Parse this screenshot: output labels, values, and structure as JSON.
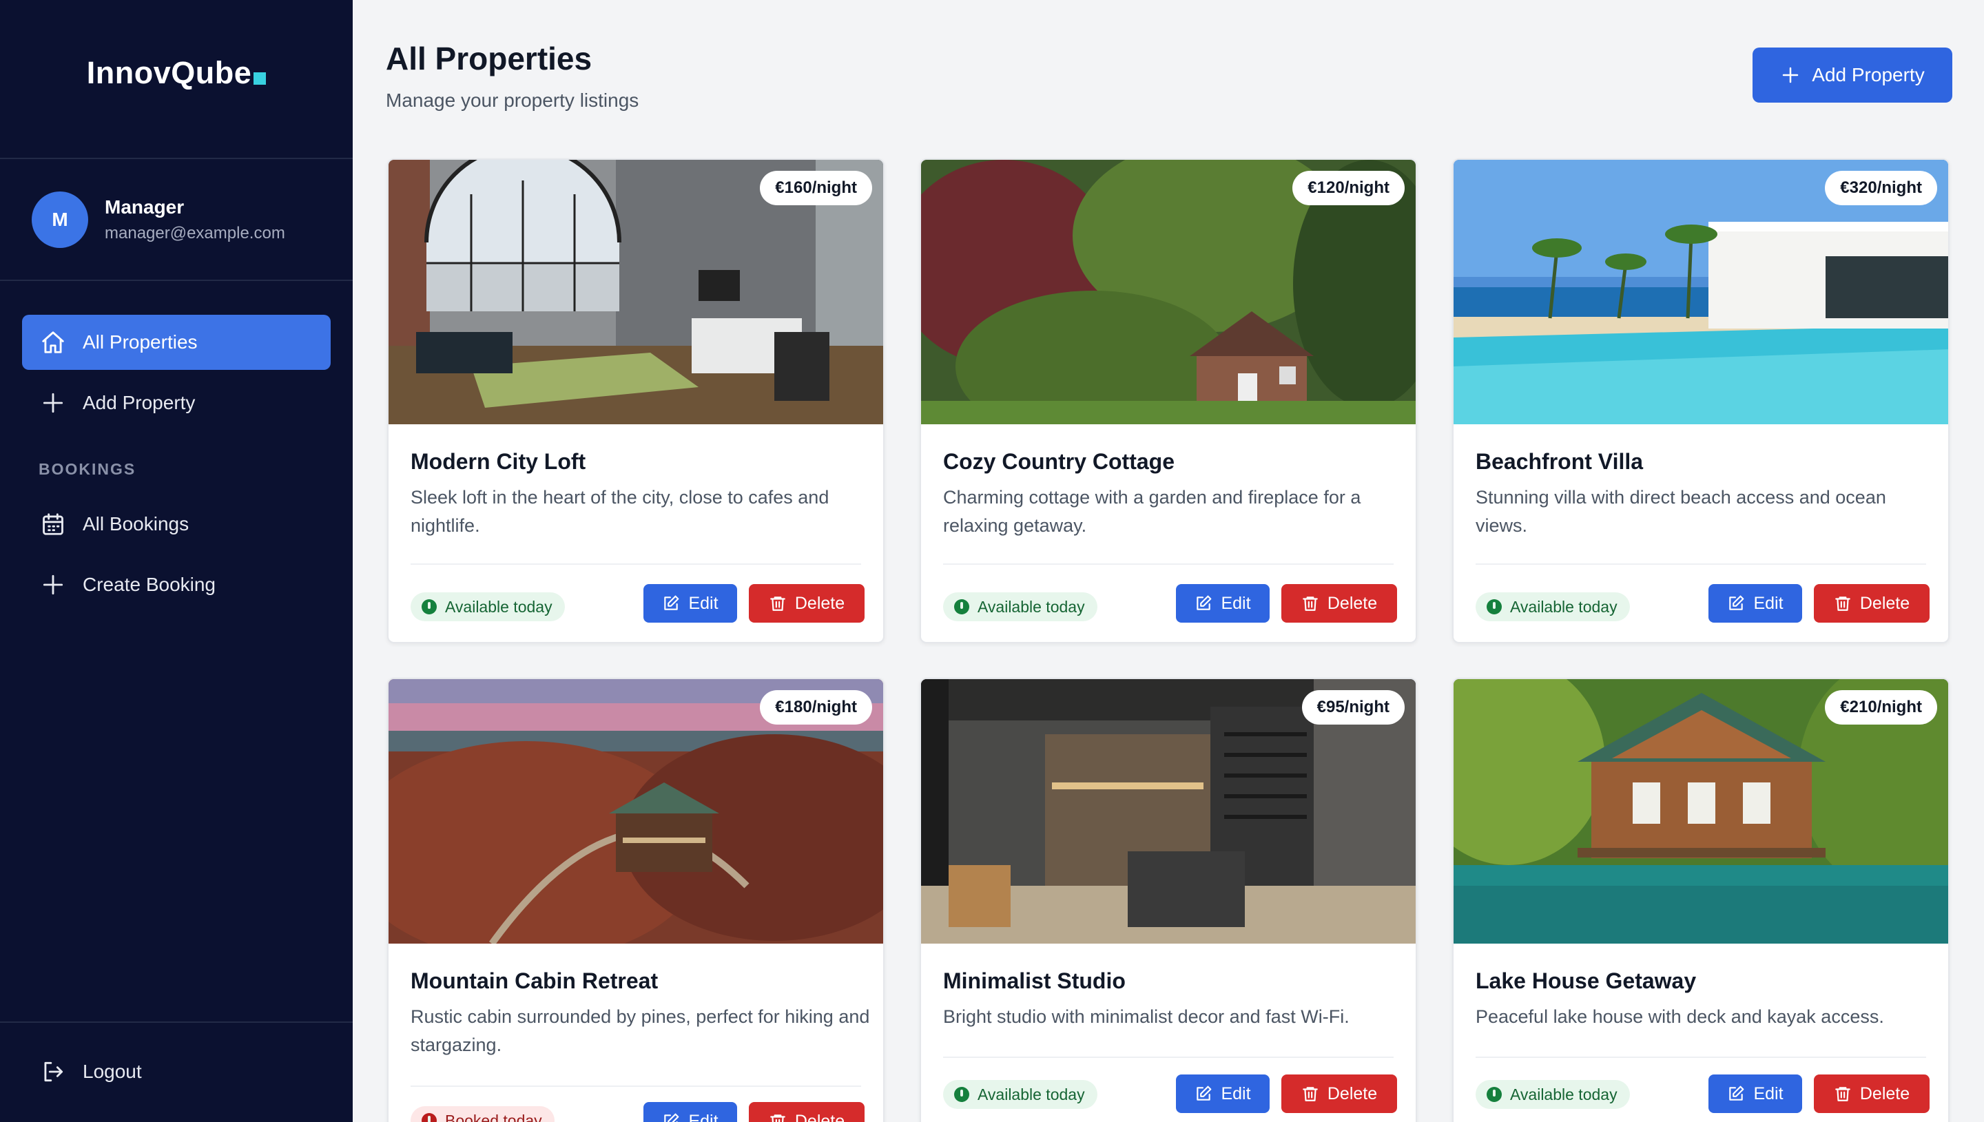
{
  "brand": {
    "name": "InnovQube"
  },
  "user": {
    "initial": "M",
    "name": "Manager",
    "email": "manager@example.com"
  },
  "nav": {
    "all_properties": "All Properties",
    "add_property": "Add Property",
    "bookings_section": "BOOKINGS",
    "all_bookings": "All Bookings",
    "create_booking": "Create Booking",
    "logout": "Logout"
  },
  "header": {
    "title": "All Properties",
    "subtitle": "Manage your property listings",
    "add_button": "Add Property"
  },
  "properties": [
    {
      "title": "Modern City Loft",
      "description": "Sleek loft in the heart of the city, close to cafes and nightlife.",
      "price": "€160/night",
      "status": "Available today",
      "edit": "Edit",
      "delete": "Delete"
    },
    {
      "title": "Cozy Country Cottage",
      "description": "Charming cottage with a garden and fireplace for a relaxing getaway.",
      "price": "€120/night",
      "status": "Available today",
      "edit": "Edit",
      "delete": "Delete"
    },
    {
      "title": "Beachfront Villa",
      "description": "Stunning villa with direct beach access and ocean views.",
      "price": "€320/night",
      "status": "Available today",
      "edit": "Edit",
      "delete": "Delete"
    },
    {
      "title": "Mountain Cabin Retreat",
      "description": "Rustic cabin surrounded by pines, perfect for hiking and stargazing.",
      "price": "€180/night",
      "status": "Booked today",
      "edit": "Edit",
      "delete": "Delete"
    },
    {
      "title": "Minimalist Studio",
      "description": "Bright studio with minimalist decor and fast Wi-Fi.",
      "price": "€95/night",
      "status": "Available today",
      "edit": "Edit",
      "delete": "Delete"
    },
    {
      "title": "Lake House Getaway",
      "description": "Peaceful lake house with deck and kayak access.",
      "price": "€210/night",
      "status": "Available today",
      "edit": "Edit",
      "delete": "Delete"
    }
  ],
  "icons": {
    "home": "home-icon",
    "plus": "plus-icon",
    "calendar": "calendar-icon",
    "logout": "logout-icon",
    "edit": "edit-icon",
    "delete": "trash-icon"
  },
  "colors": {
    "sidebar_bg": "#0b1130",
    "primary": "#2f65e0",
    "danger": "#d52b2b",
    "available": "#15803d",
    "booked": "#b91c1c"
  }
}
